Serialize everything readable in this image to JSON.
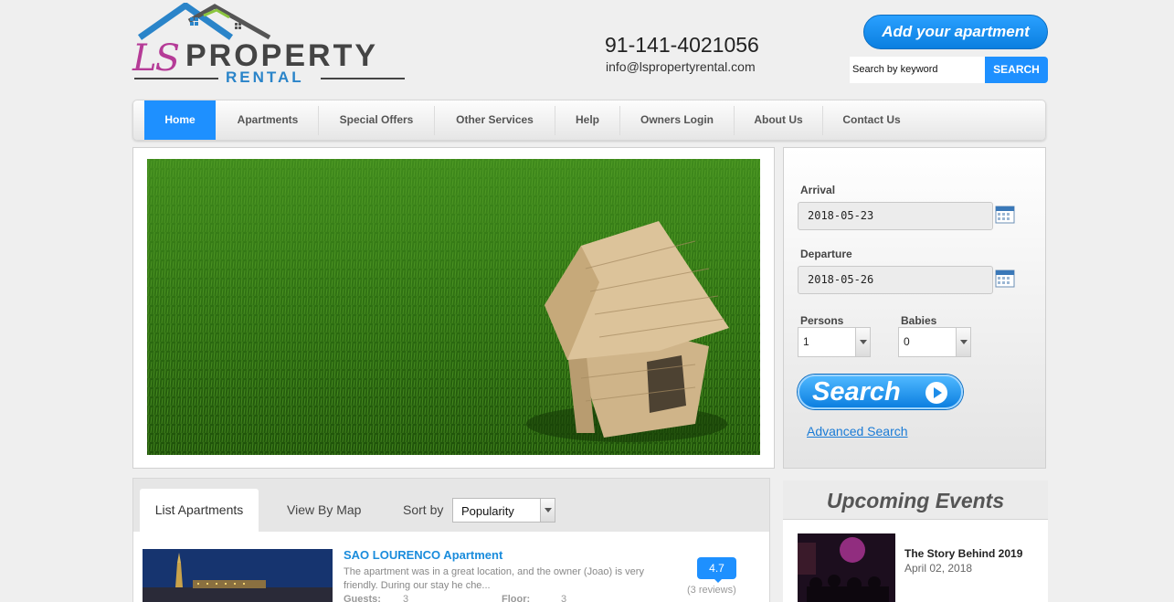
{
  "header": {
    "logo": {
      "initials": "LS",
      "word1": "PROPERTY",
      "word2": "RENTAL"
    },
    "phone": "91-141-4021056",
    "email": "info@lspropertyrental.com",
    "add_apartment_label": "Add your apartment",
    "search_placeholder": "Search by keyword",
    "search_button_label": "SEARCH"
  },
  "nav": {
    "items": [
      {
        "label": "Home",
        "active": true
      },
      {
        "label": "Apartments"
      },
      {
        "label": "Special Offers"
      },
      {
        "label": "Other Services"
      },
      {
        "label": "Help"
      },
      {
        "label": "Owners Login"
      },
      {
        "label": "About Us"
      },
      {
        "label": "Contact Us"
      }
    ]
  },
  "booking": {
    "arrival_label": "Arrival",
    "arrival_value": "2018-05-23",
    "departure_label": "Departure",
    "departure_value": "2018-05-26",
    "persons_label": "Persons",
    "persons_value": "1",
    "babies_label": "Babies",
    "babies_value": "0",
    "search_label": "Search",
    "advanced_label": "Advanced Search"
  },
  "listing": {
    "tab_list": "List Apartments",
    "tab_map": "View By Map",
    "sort_label": "Sort by",
    "sort_value": "Popularity",
    "apartment": {
      "title": "SAO LOURENCO Apartment",
      "description": "The apartment was in a great location, and the owner (Joao) is very friendly. During our stay he che...",
      "guests_label": "Guests:",
      "guests_value": "3",
      "floor_label": "Floor:",
      "floor_value": "3",
      "rating": "4.7",
      "reviews": "(3 reviews)"
    }
  },
  "events": {
    "heading": "Upcoming Events",
    "item": {
      "title": "The Story Behind 2019",
      "date": "April 02, 2018"
    }
  },
  "colors": {
    "accent": "#1e90ff",
    "logo_magenta": "#b53b97",
    "link_blue": "#1a7bd6"
  }
}
